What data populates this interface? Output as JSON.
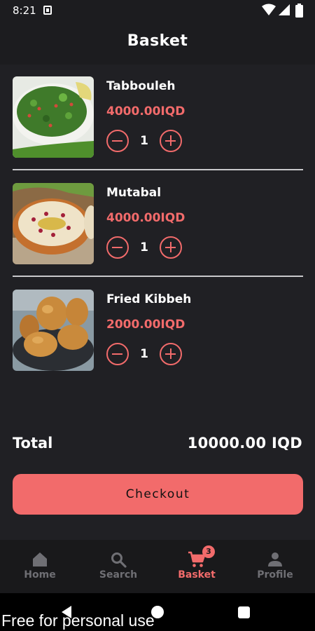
{
  "status_bar": {
    "time": "8:21",
    "icons": [
      "notification-icon",
      "wifi-icon",
      "signal-icon",
      "battery-icon"
    ]
  },
  "header": {
    "title": "Basket"
  },
  "basket": {
    "items": [
      {
        "name": "Tabbouleh",
        "price": "4000.00IQD",
        "quantity": "1",
        "image": "tabbouleh-photo"
      },
      {
        "name": "Mutabal",
        "price": "4000.00IQD",
        "quantity": "1",
        "image": "mutabal-photo"
      },
      {
        "name": "Fried Kibbeh",
        "price": "2000.00IQD",
        "quantity": "1",
        "image": "fried-kibbeh-photo"
      }
    ],
    "total_label": "Total",
    "total_value": "10000.00 IQD",
    "checkout_label": "Checkout"
  },
  "bottom_nav": {
    "items": [
      {
        "label": "Home",
        "icon": "home-icon",
        "active": false
      },
      {
        "label": "Search",
        "icon": "search-icon",
        "active": false
      },
      {
        "label": "Basket",
        "icon": "cart-icon",
        "active": true,
        "badge": "3"
      },
      {
        "label": "Profile",
        "icon": "person-icon",
        "active": false
      }
    ]
  },
  "colors": {
    "accent": "#f26b6b",
    "background": "#202024",
    "header_background": "#1c1c1f",
    "nav_background": "#19191b",
    "inactive": "#6f6f74"
  },
  "watermark": "Free for personal use"
}
